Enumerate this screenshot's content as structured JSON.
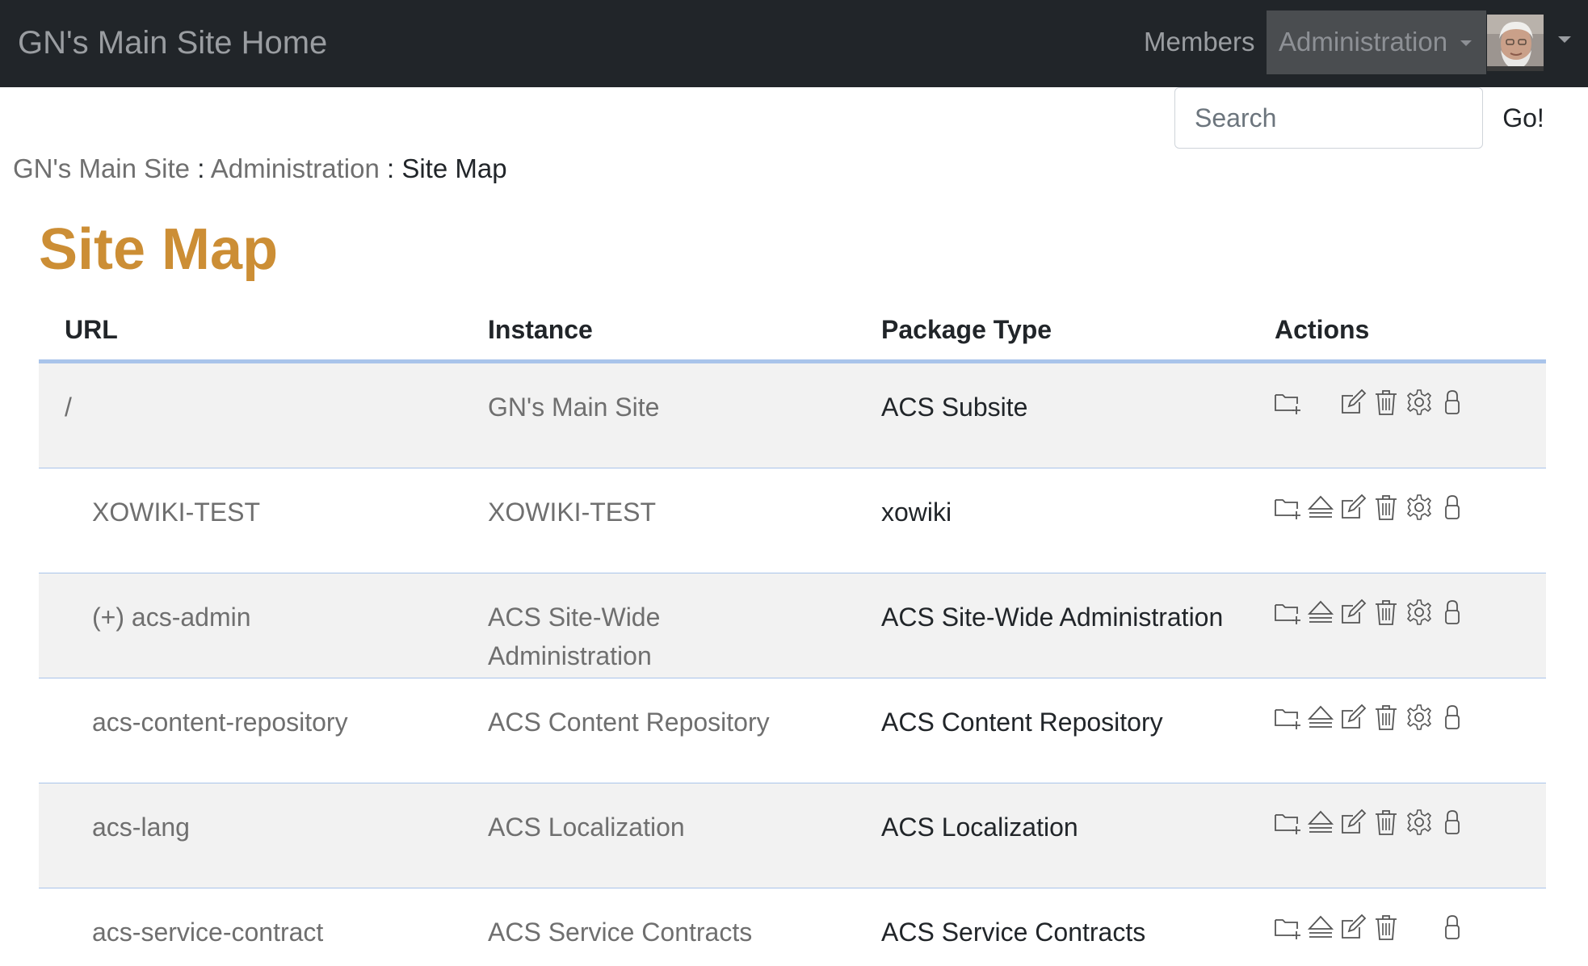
{
  "navbar": {
    "brand": "GN's Main Site Home",
    "members": "Members",
    "administration": "Administration"
  },
  "search": {
    "placeholder": "Search",
    "go": "Go!"
  },
  "breadcrumb": {
    "home": "GN's Main Site",
    "sep1": " : ",
    "admin": "Administration",
    "sep2": " : ",
    "current": "Site Map"
  },
  "page_title": "Site Map",
  "table": {
    "headers": {
      "url": "URL",
      "instance": "Instance",
      "package_type": "Package Type",
      "actions": "Actions"
    },
    "rows": [
      {
        "url": "/",
        "instance": "GN's Main Site",
        "package_type": "ACS Subsite",
        "actions": [
          "new-folder-icon",
          "edit-icon",
          "delete-icon",
          "settings-icon",
          "permissions-lock-icon"
        ]
      },
      {
        "url": "XOWIKI-TEST",
        "instance": "XOWIKI-TEST",
        "package_type": "xowiki",
        "actions": [
          "new-folder-icon",
          "unmount-icon",
          "edit-icon",
          "delete-icon",
          "settings-icon",
          "permissions-lock-icon"
        ]
      },
      {
        "url": "(+) acs-admin",
        "instance": "ACS Site-Wide Administration",
        "package_type": "ACS Site-Wide Administration",
        "actions": [
          "new-folder-icon",
          "unmount-icon",
          "edit-icon",
          "delete-icon",
          "settings-icon",
          "permissions-lock-icon"
        ]
      },
      {
        "url": "acs-content-repository",
        "instance": "ACS Content Repository",
        "package_type": "ACS Content Repository",
        "actions": [
          "new-folder-icon",
          "unmount-icon",
          "edit-icon",
          "delete-icon",
          "settings-icon",
          "permissions-lock-icon"
        ]
      },
      {
        "url": "acs-lang",
        "instance": "ACS Localization",
        "package_type": "ACS Localization",
        "actions": [
          "new-folder-icon",
          "unmount-icon",
          "edit-icon",
          "delete-icon",
          "settings-icon",
          "permissions-lock-icon"
        ]
      },
      {
        "url": "acs-service-contract",
        "instance": "ACS Service Contracts",
        "package_type": "ACS Service Contracts",
        "actions": [
          "new-folder-icon",
          "unmount-icon",
          "edit-icon",
          "delete-icon",
          "permissions-lock-icon"
        ]
      }
    ]
  },
  "colors": {
    "navbar_bg": "#212529",
    "title": "#cc8e35",
    "link_gray": "#6f6f6f",
    "row_divider": "#a9c4ea",
    "row_stripe": "#f2f2f2"
  }
}
